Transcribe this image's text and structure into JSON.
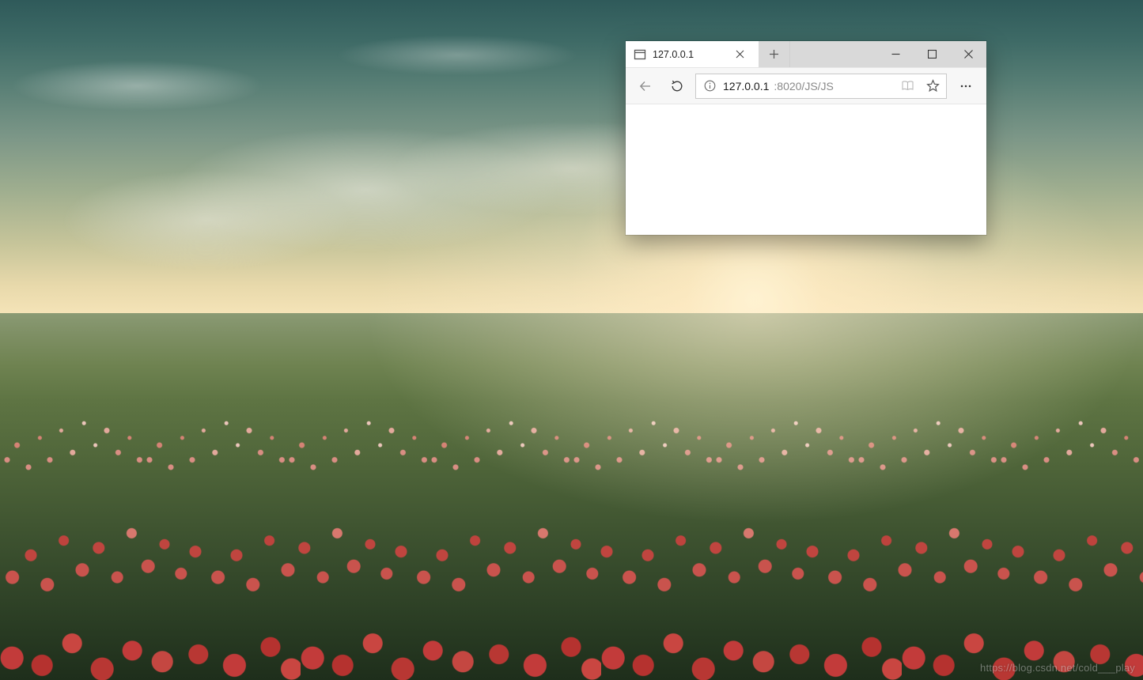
{
  "wallpaper": {
    "description": "poppy-field-sunset",
    "watermark": "https://blog.csdn.net/cold___play"
  },
  "browser": {
    "name": "microsoft-edge-legacy",
    "tab": {
      "title": "127.0.0.1",
      "favicon": "page-icon"
    },
    "address": {
      "host": "127.0.0.1",
      "rest": ":8020/JS/JS",
      "full": "127.0.0.1:8020/JS/JS"
    },
    "buttons": {
      "back_disabled": true,
      "forward_visible": false
    },
    "icons": {
      "new_tab": "plus-icon",
      "minimize": "minimize-icon",
      "maximize": "maximize-icon",
      "close_window": "close-icon",
      "close_tab": "close-icon",
      "back": "arrow-left-icon",
      "refresh": "refresh-icon",
      "site_info": "info-icon",
      "reading_view": "book-icon",
      "favorite": "star-icon",
      "more": "dots-icon"
    }
  }
}
